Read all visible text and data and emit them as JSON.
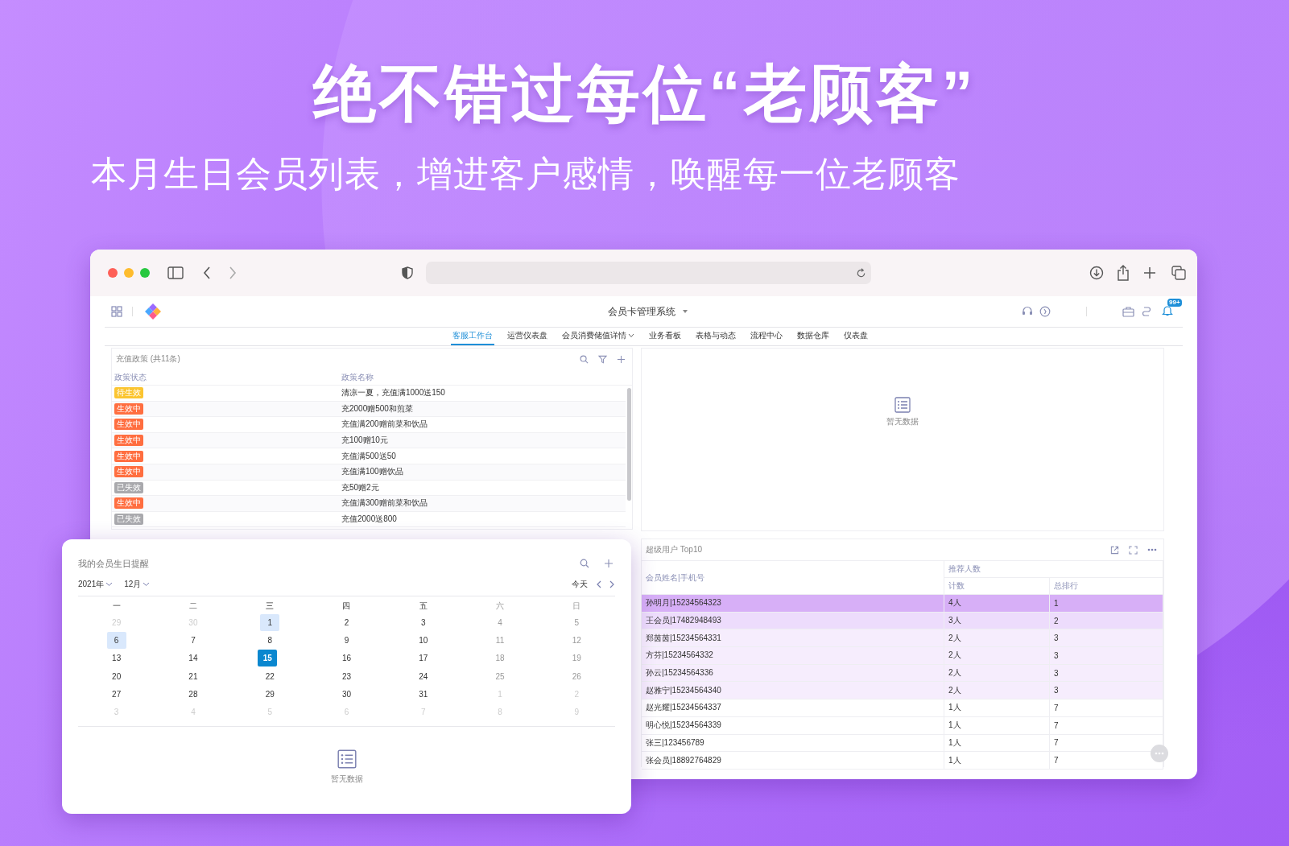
{
  "headline": "绝不错过每位“老顾客”",
  "subtitle": "本月生日会员列表，增进客户感情，唤醒每一位老顾客",
  "app": {
    "title": "会员卡管理系统",
    "notification_badge": "99+",
    "tabs": [
      {
        "label": "客服工作台",
        "selected": true,
        "has_menu": false
      },
      {
        "label": "运营仪表盘",
        "selected": false,
        "has_menu": false
      },
      {
        "label": "会员消费储值详情",
        "selected": false,
        "has_menu": true
      },
      {
        "label": "业务看板",
        "selected": false,
        "has_menu": false
      },
      {
        "label": "表格与动态",
        "selected": false,
        "has_menu": false
      },
      {
        "label": "流程中心",
        "selected": false,
        "has_menu": false
      },
      {
        "label": "数据仓库",
        "selected": false,
        "has_menu": false
      },
      {
        "label": "仪表盘",
        "selected": false,
        "has_menu": false
      }
    ]
  },
  "policy_panel": {
    "title": "充值政策 (共11条)",
    "columns": [
      "政策状态",
      "政策名称"
    ],
    "rows": [
      {
        "status": "待生效",
        "color": "#fbc531",
        "name": "清凉一夏，充值满1000送150"
      },
      {
        "status": "生效中",
        "color": "#ff6e40",
        "name": "充2000赠500和煎菜"
      },
      {
        "status": "生效中",
        "color": "#ff6e40",
        "name": "充值满200赠前菜和饮品"
      },
      {
        "status": "生效中",
        "color": "#ff6e40",
        "name": "充100赠10元"
      },
      {
        "status": "生效中",
        "color": "#ff6e40",
        "name": "充值满500送50"
      },
      {
        "status": "生效中",
        "color": "#ff6e40",
        "name": "充值满100赠饮品"
      },
      {
        "status": "已失效",
        "color": "#a9a9ad",
        "name": "充50赠2元"
      },
      {
        "status": "生效中",
        "color": "#ff6e40",
        "name": "充值满300赠前菜和饮品"
      },
      {
        "status": "已失效",
        "color": "#a9a9ad",
        "name": "充值2000送800"
      }
    ]
  },
  "empty_panel": {
    "message": "暂无数据"
  },
  "top_users_panel": {
    "title": "超级用户 Top10",
    "name_column": "会员姓名|手机号",
    "group_column": "推荐人数",
    "sub_columns": [
      "计数",
      "总排行"
    ],
    "rows": [
      {
        "name": "孙明月|15234564323",
        "count": "4人",
        "rank": "1",
        "kind": "first"
      },
      {
        "name": "王会员|17482948493",
        "count": "3人",
        "rank": "2",
        "kind": "second"
      },
      {
        "name": "郑茵茵|15234564331",
        "count": "2人",
        "rank": "3",
        "kind": "third"
      },
      {
        "name": "方芬|15234564332",
        "count": "2人",
        "rank": "3",
        "kind": "third"
      },
      {
        "name": "孙云|15234564336",
        "count": "2人",
        "rank": "3",
        "kind": "third"
      },
      {
        "name": "赵雅宁|15234564340",
        "count": "2人",
        "rank": "3",
        "kind": "third"
      },
      {
        "name": "赵光耀|15234564337",
        "count": "1人",
        "rank": "7",
        "kind": "normal"
      },
      {
        "name": "明心悦|15234564339",
        "count": "1人",
        "rank": "7",
        "kind": "normal"
      },
      {
        "name": "张三|123456789",
        "count": "1人",
        "rank": "7",
        "kind": "normal"
      },
      {
        "name": "张会员|18892764829",
        "count": "1人",
        "rank": "7",
        "kind": "normal"
      }
    ]
  },
  "birthday_panel": {
    "title": "我的会员生日提醒",
    "year": "2021年",
    "month": "12月",
    "today_button": "今天",
    "weekdays": [
      {
        "label": "一",
        "kind": "weekday"
      },
      {
        "label": "二",
        "kind": "weekday"
      },
      {
        "label": "三",
        "kind": "weekday"
      },
      {
        "label": "四",
        "kind": "weekday"
      },
      {
        "label": "五",
        "kind": "weekday"
      },
      {
        "label": "六",
        "kind": "weekend"
      },
      {
        "label": "日",
        "kind": "weekend"
      }
    ],
    "weeks": [
      [
        {
          "label": "29",
          "kind": "other",
          "marked": false,
          "selected": false
        },
        {
          "label": "30",
          "kind": "other",
          "marked": false,
          "selected": false
        },
        {
          "label": "1",
          "kind": "weekday",
          "marked": true,
          "selected": false
        },
        {
          "label": "2",
          "kind": "weekday",
          "marked": false,
          "selected": false
        },
        {
          "label": "3",
          "kind": "weekday",
          "marked": false,
          "selected": false
        },
        {
          "label": "4",
          "kind": "weekend",
          "marked": false,
          "selected": false
        },
        {
          "label": "5",
          "kind": "weekend",
          "marked": false,
          "selected": false
        }
      ],
      [
        {
          "label": "6",
          "kind": "weekday",
          "marked": true,
          "selected": false
        },
        {
          "label": "7",
          "kind": "weekday",
          "marked": false,
          "selected": false
        },
        {
          "label": "8",
          "kind": "weekday",
          "marked": false,
          "selected": false
        },
        {
          "label": "9",
          "kind": "weekday",
          "marked": false,
          "selected": false
        },
        {
          "label": "10",
          "kind": "weekday",
          "marked": false,
          "selected": false
        },
        {
          "label": "11",
          "kind": "weekend",
          "marked": false,
          "selected": false
        },
        {
          "label": "12",
          "kind": "weekend",
          "marked": false,
          "selected": false
        }
      ],
      [
        {
          "label": "13",
          "kind": "weekday",
          "marked": false,
          "selected": false
        },
        {
          "label": "14",
          "kind": "weekday",
          "marked": false,
          "selected": false
        },
        {
          "label": "15",
          "kind": "weekday",
          "marked": false,
          "selected": true
        },
        {
          "label": "16",
          "kind": "weekday",
          "marked": false,
          "selected": false
        },
        {
          "label": "17",
          "kind": "weekday",
          "marked": false,
          "selected": false
        },
        {
          "label": "18",
          "kind": "weekend",
          "marked": false,
          "selected": false
        },
        {
          "label": "19",
          "kind": "weekend",
          "marked": false,
          "selected": false
        }
      ],
      [
        {
          "label": "20",
          "kind": "weekday",
          "marked": false,
          "selected": false
        },
        {
          "label": "21",
          "kind": "weekday",
          "marked": false,
          "selected": false
        },
        {
          "label": "22",
          "kind": "weekday",
          "marked": false,
          "selected": false
        },
        {
          "label": "23",
          "kind": "weekday",
          "marked": false,
          "selected": false
        },
        {
          "label": "24",
          "kind": "weekday",
          "marked": false,
          "selected": false
        },
        {
          "label": "25",
          "kind": "weekend",
          "marked": false,
          "selected": false
        },
        {
          "label": "26",
          "kind": "weekend",
          "marked": false,
          "selected": false
        }
      ],
      [
        {
          "label": "27",
          "kind": "weekday",
          "marked": false,
          "selected": false
        },
        {
          "label": "28",
          "kind": "weekday",
          "marked": false,
          "selected": false
        },
        {
          "label": "29",
          "kind": "weekday",
          "marked": false,
          "selected": false
        },
        {
          "label": "30",
          "kind": "weekday",
          "marked": false,
          "selected": false
        },
        {
          "label": "31",
          "kind": "weekday",
          "marked": false,
          "selected": false
        },
        {
          "label": "1",
          "kind": "other",
          "marked": false,
          "selected": false
        },
        {
          "label": "2",
          "kind": "other",
          "marked": false,
          "selected": false
        }
      ],
      [
        {
          "label": "3",
          "kind": "other",
          "marked": false,
          "selected": false
        },
        {
          "label": "4",
          "kind": "other",
          "marked": false,
          "selected": false
        },
        {
          "label": "5",
          "kind": "other",
          "marked": false,
          "selected": false
        },
        {
          "label": "6",
          "kind": "other",
          "marked": false,
          "selected": false
        },
        {
          "label": "7",
          "kind": "other",
          "marked": false,
          "selected": false
        },
        {
          "label": "8",
          "kind": "other",
          "marked": false,
          "selected": false
        },
        {
          "label": "9",
          "kind": "other",
          "marked": false,
          "selected": false
        }
      ]
    ],
    "empty_message": "暂无数据"
  }
}
